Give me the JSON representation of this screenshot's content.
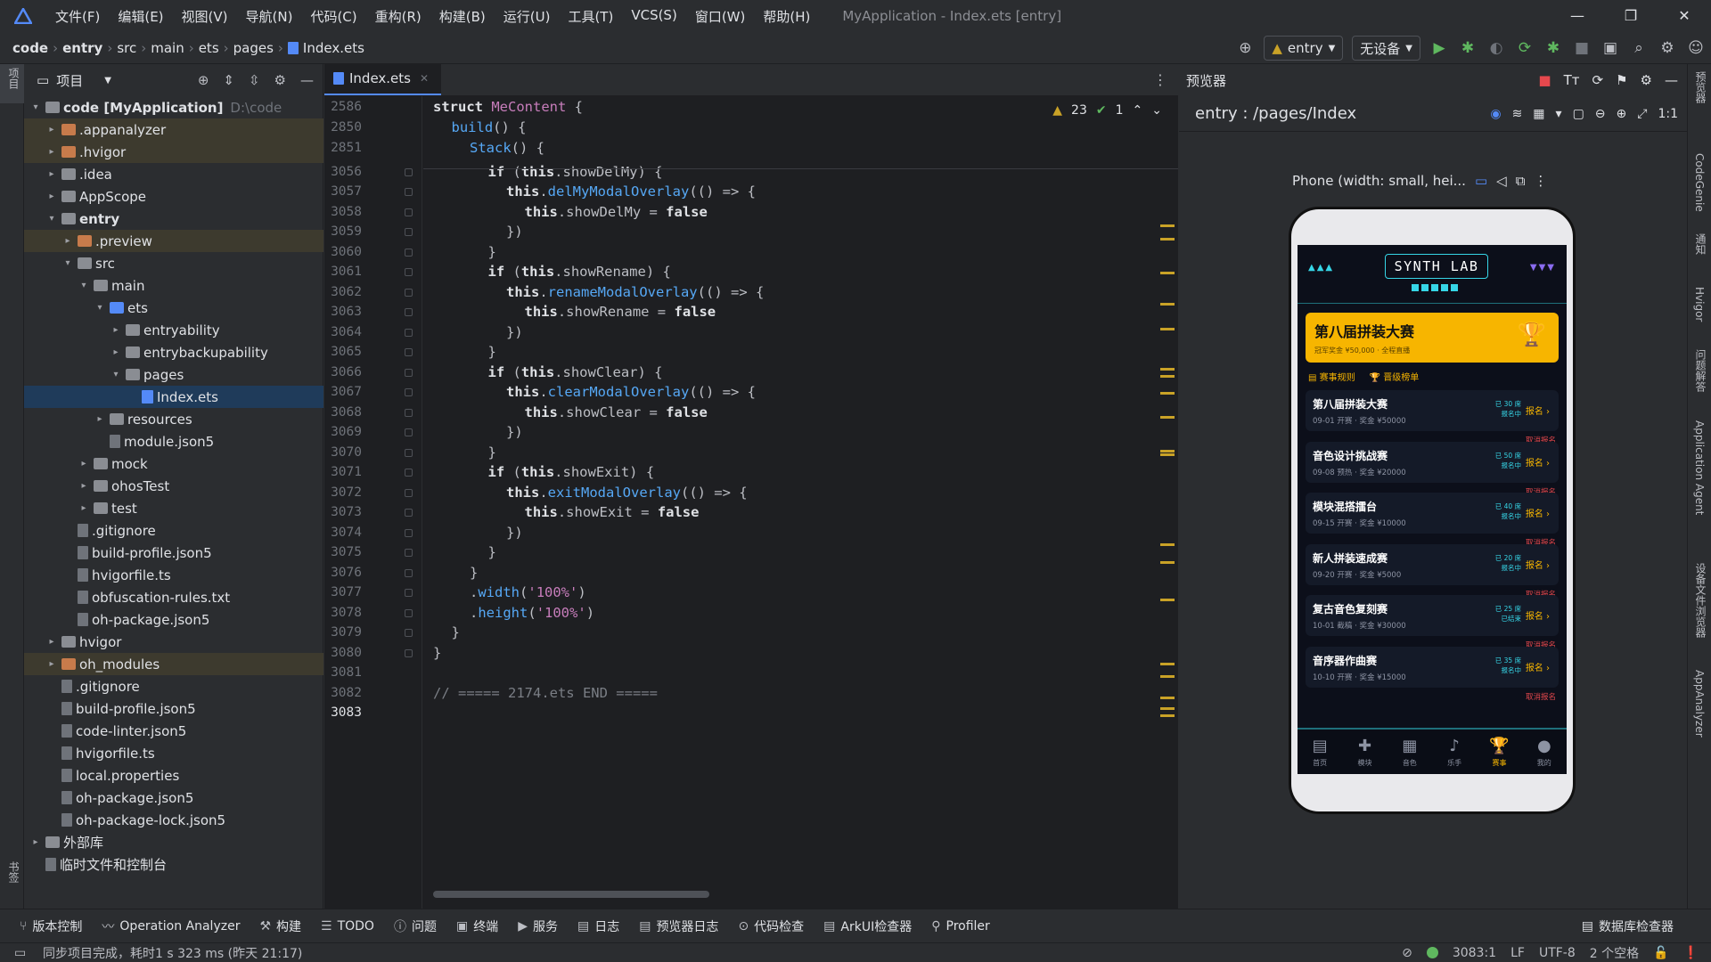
{
  "menubar": {
    "items": [
      "文件(F)",
      "编辑(E)",
      "视图(V)",
      "导航(N)",
      "代码(C)",
      "重构(R)",
      "构建(B)",
      "运行(U)",
      "工具(T)",
      "VCS(S)",
      "窗口(W)",
      "帮助(H)"
    ],
    "window_title": "MyApplication - Index.ets [entry]",
    "minimize_icon": "minimize-icon",
    "maximize_icon": "maximize-icon",
    "close_icon": "close-icon"
  },
  "breadcrumb": [
    "code",
    "entry",
    "src",
    "main",
    "ets",
    "pages",
    "Index.ets"
  ],
  "toolbar": {
    "module": "entry",
    "device": "无设备"
  },
  "project_panel": {
    "title": "项目",
    "strip_label": "项目",
    "strip_bottom_labels": [
      "书签",
      "结构"
    ]
  },
  "tree": [
    {
      "label": "code [MyApplication]",
      "extra": "D:\\code",
      "depth": 0,
      "arrow": "▾",
      "icon": "folder",
      "bold": true
    },
    {
      "label": ".appanalyzer",
      "depth": 1,
      "arrow": "▸",
      "icon": "ofolder",
      "excluded": true
    },
    {
      "label": ".hvigor",
      "depth": 1,
      "arrow": "▸",
      "icon": "ofolder",
      "excluded": true
    },
    {
      "label": ".idea",
      "depth": 1,
      "arrow": "▸",
      "icon": "folder"
    },
    {
      "label": "AppScope",
      "depth": 1,
      "arrow": "▸",
      "icon": "folder"
    },
    {
      "label": "entry",
      "depth": 1,
      "arrow": "▾",
      "icon": "folder",
      "bold": true
    },
    {
      "label": ".preview",
      "depth": 2,
      "arrow": "▸",
      "icon": "ofolder",
      "excluded": true
    },
    {
      "label": "src",
      "depth": 2,
      "arrow": "▾",
      "icon": "folder"
    },
    {
      "label": "main",
      "depth": 3,
      "arrow": "▾",
      "icon": "folder"
    },
    {
      "label": "ets",
      "depth": 4,
      "arrow": "▾",
      "icon": "bfolder"
    },
    {
      "label": "entryability",
      "depth": 5,
      "arrow": "▸",
      "icon": "folder"
    },
    {
      "label": "entrybackupability",
      "depth": 5,
      "arrow": "▸",
      "icon": "folder"
    },
    {
      "label": "pages",
      "depth": 5,
      "arrow": "▾",
      "icon": "folder"
    },
    {
      "label": "Index.ets",
      "depth": 6,
      "arrow": "",
      "icon": "ets",
      "selected": true
    },
    {
      "label": "resources",
      "depth": 4,
      "arrow": "▸",
      "icon": "folder"
    },
    {
      "label": "module.json5",
      "depth": 4,
      "arrow": "",
      "icon": "file"
    },
    {
      "label": "mock",
      "depth": 3,
      "arrow": "▸",
      "icon": "folder"
    },
    {
      "label": "ohosTest",
      "depth": 3,
      "arrow": "▸",
      "icon": "folder"
    },
    {
      "label": "test",
      "depth": 3,
      "arrow": "▸",
      "icon": "folder"
    },
    {
      "label": ".gitignore",
      "depth": 2,
      "arrow": "",
      "icon": "file"
    },
    {
      "label": "build-profile.json5",
      "depth": 2,
      "arrow": "",
      "icon": "file"
    },
    {
      "label": "hvigorfile.ts",
      "depth": 2,
      "arrow": "",
      "icon": "file"
    },
    {
      "label": "obfuscation-rules.txt",
      "depth": 2,
      "arrow": "",
      "icon": "file"
    },
    {
      "label": "oh-package.json5",
      "depth": 2,
      "arrow": "",
      "icon": "file"
    },
    {
      "label": "hvigor",
      "depth": 1,
      "arrow": "▸",
      "icon": "folder"
    },
    {
      "label": "oh_modules",
      "depth": 1,
      "arrow": "▸",
      "icon": "ofolder",
      "excluded": true
    },
    {
      "label": ".gitignore",
      "depth": 1,
      "arrow": "",
      "icon": "file"
    },
    {
      "label": "build-profile.json5",
      "depth": 1,
      "arrow": "",
      "icon": "file"
    },
    {
      "label": "code-linter.json5",
      "depth": 1,
      "arrow": "",
      "icon": "file"
    },
    {
      "label": "hvigorfile.ts",
      "depth": 1,
      "arrow": "",
      "icon": "file"
    },
    {
      "label": "local.properties",
      "depth": 1,
      "arrow": "",
      "icon": "file"
    },
    {
      "label": "oh-package.json5",
      "depth": 1,
      "arrow": "",
      "icon": "file"
    },
    {
      "label": "oh-package-lock.json5",
      "depth": 1,
      "arrow": "",
      "icon": "file"
    },
    {
      "label": "外部库",
      "depth": 0,
      "arrow": "▸",
      "icon": "folder"
    },
    {
      "label": "临时文件和控制台",
      "depth": 0,
      "arrow": "",
      "icon": "file"
    }
  ],
  "editor": {
    "tab": "Index.ets",
    "warnings": "23",
    "ok": "1",
    "lines": [
      {
        "n": "2586",
        "html": "<span class='kwb'>struct</span> <span class='typ'>MeContent</span> {",
        "ind": 0
      },
      {
        "n": "2850",
        "html": "<span class='fn'>build</span>() {",
        "ind": 1
      },
      {
        "n": "2851",
        "html": "<span class='fn'>Stack</span>() {",
        "ind": 2
      },
      {
        "n": "3056",
        "html": "<span class='kwb'>if</span> (<span class='kwb'>this</span>.showDelMy) {",
        "ind": 3
      },
      {
        "n": "3057",
        "html": "<span class='kwb'>this</span>.<span class='fn'>delMyModalOverlay</span>(() => {",
        "ind": 4
      },
      {
        "n": "3058",
        "html": "<span class='kwb'>this</span>.showDelMy = <span class='kwb'>false</span>",
        "ind": 5
      },
      {
        "n": "3059",
        "html": "})",
        "ind": 4
      },
      {
        "n": "3060",
        "html": "}",
        "ind": 3
      },
      {
        "n": "3061",
        "html": "<span class='kwb'>if</span> (<span class='kwb'>this</span>.showRename) {",
        "ind": 3
      },
      {
        "n": "3062",
        "html": "<span class='kwb'>this</span>.<span class='fn'>renameModalOverlay</span>(() => {",
        "ind": 4
      },
      {
        "n": "3063",
        "html": "<span class='kwb'>this</span>.showRename = <span class='kwb'>false</span>",
        "ind": 5
      },
      {
        "n": "3064",
        "html": "})",
        "ind": 4
      },
      {
        "n": "3065",
        "html": "}",
        "ind": 3
      },
      {
        "n": "3066",
        "html": "<span class='kwb'>if</span> (<span class='kwb'>this</span>.showClear) {",
        "ind": 3
      },
      {
        "n": "3067",
        "html": "<span class='kwb'>this</span>.<span class='fn'>clearModalOverlay</span>(() => {",
        "ind": 4
      },
      {
        "n": "3068",
        "html": "<span class='kwb'>this</span>.showClear = <span class='kwb'>false</span>",
        "ind": 5
      },
      {
        "n": "3069",
        "html": "})",
        "ind": 4
      },
      {
        "n": "3070",
        "html": "}",
        "ind": 3
      },
      {
        "n": "3071",
        "html": "<span class='kwb'>if</span> (<span class='kwb'>this</span>.showExit) {",
        "ind": 3
      },
      {
        "n": "3072",
        "html": "<span class='kwb'>this</span>.<span class='fn'>exitModalOverlay</span>(() => {",
        "ind": 4
      },
      {
        "n": "3073",
        "html": "<span class='kwb'>this</span>.showExit = <span class='kwb'>false</span>",
        "ind": 5
      },
      {
        "n": "3074",
        "html": "})",
        "ind": 4
      },
      {
        "n": "3075",
        "html": "}",
        "ind": 3
      },
      {
        "n": "3076",
        "html": "}",
        "ind": 2
      },
      {
        "n": "3077",
        "html": ".<span class='fn'>width</span>(<span class='pur'>'100%'</span>)",
        "ind": 2
      },
      {
        "n": "3078",
        "html": ".<span class='fn'>height</span>(<span class='pur'>'100%'</span>)",
        "ind": 2
      },
      {
        "n": "3079",
        "html": "}",
        "ind": 1
      },
      {
        "n": "3080",
        "html": "}",
        "ind": 0
      },
      {
        "n": "3081",
        "html": "",
        "ind": 0
      },
      {
        "n": "3082",
        "html": "<span class='cm'>// ===== 2174.ets END =====</span>",
        "ind": 0
      },
      {
        "n": "3083",
        "html": "",
        "ind": 0
      }
    ]
  },
  "preview": {
    "title": "预览器",
    "route": "entry : /pages/Index",
    "device": "Phone (width: small, hei...",
    "app": {
      "logo": "SYNTH LAB",
      "banner_title": "第八届拼装大赛",
      "banner_sub": "冠军奖金 ¥50,000 · 全程直播",
      "rules": [
        "赛事规则",
        "晋级榜单"
      ],
      "cards": [
        {
          "t": "第八届拼装大赛",
          "s": "09-01 开赛 · 奖金 ¥50000",
          "c1": "已 30 席",
          "c2": "报名中",
          "go": "报名 ›",
          "cancel": "取消报名"
        },
        {
          "t": "音色设计挑战赛",
          "s": "09-08 预热 · 奖金 ¥20000",
          "c1": "已 50 席",
          "c2": "报名中",
          "go": "报名 ›",
          "cancel": "取消报名"
        },
        {
          "t": "模块混搭擂台",
          "s": "09-15 开赛 · 奖金 ¥10000",
          "c1": "已 40 席",
          "c2": "报名中",
          "go": "报名 ›",
          "cancel": "取消报名"
        },
        {
          "t": "新人拼装速成赛",
          "s": "09-20 开赛 · 奖金 ¥5000",
          "c1": "已 20 席",
          "c2": "报名中",
          "go": "报名 ›",
          "cancel": "取消报名"
        },
        {
          "t": "复古音色复刻赛",
          "s": "10-01 截稿 · 奖金 ¥30000",
          "c1": "已 25 席",
          "c2": "已结束",
          "go": "报名 ›",
          "cancel": "取消报名"
        },
        {
          "t": "音序器作曲赛",
          "s": "10-10 开赛 · 奖金 ¥15000",
          "c1": "已 35 席",
          "c2": "报名中",
          "go": "报名 ›",
          "cancel": "取消报名"
        }
      ],
      "tabs": [
        {
          "label": "首页",
          "icon": "▤"
        },
        {
          "label": "模块",
          "icon": "✚"
        },
        {
          "label": "音色",
          "icon": "▦"
        },
        {
          "label": "乐手",
          "icon": "♪"
        },
        {
          "label": "赛事",
          "icon": "🏆",
          "active": true
        },
        {
          "label": "我的",
          "icon": "●"
        }
      ]
    }
  },
  "right_strip": [
    "预览器",
    "CodeGenie",
    "通知",
    "Hvigor",
    "问题解答",
    "Application Agent",
    "设备文件浏览器",
    "AppAnalyzer"
  ],
  "toolwindows": [
    "版本控制",
    "Operation Analyzer",
    "构建",
    "TODO",
    "问题",
    "终端",
    "服务",
    "日志",
    "预览器日志",
    "代码检查",
    "ArkUI检查器",
    "Profiler"
  ],
  "toolwindow_right": "数据库检查器",
  "status": {
    "message": "同步项目完成，耗时1 s 323 ms (昨天 21:17)",
    "position": "3083:1",
    "line_sep": "LF",
    "encoding": "UTF-8",
    "indent": "2 个空格"
  }
}
